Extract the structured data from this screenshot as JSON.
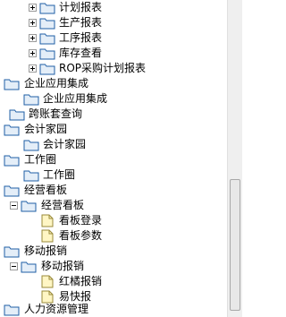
{
  "tree": {
    "items": [
      {
        "label": "计划报表",
        "icon": "folder-icon"
      },
      {
        "label": "生产报表",
        "icon": "folder-icon"
      },
      {
        "label": "工序报表",
        "icon": "folder-icon"
      },
      {
        "label": "库存查看",
        "icon": "folder-icon"
      },
      {
        "label": "ROP采购计划报表",
        "icon": "folder-icon"
      },
      {
        "label": "企业应用集成",
        "icon": "folder-icon"
      },
      {
        "label": "企业应用集成",
        "icon": "folder-icon"
      },
      {
        "label": "跨账套查询",
        "icon": "folder-icon"
      },
      {
        "label": "会计家园",
        "icon": "folder-icon"
      },
      {
        "label": "会计家园",
        "icon": "folder-icon"
      },
      {
        "label": "工作圈",
        "icon": "folder-icon"
      },
      {
        "label": "工作圈",
        "icon": "folder-icon"
      },
      {
        "label": "经营看板",
        "icon": "folder-icon"
      },
      {
        "label": "经营看板",
        "icon": "folder-icon"
      },
      {
        "label": "看板登录",
        "icon": "document-icon"
      },
      {
        "label": "看板参数",
        "icon": "document-icon"
      },
      {
        "label": "移动报销",
        "icon": "folder-icon"
      },
      {
        "label": "移动报销",
        "icon": "folder-icon"
      },
      {
        "label": "红橘报销",
        "icon": "document-icon"
      },
      {
        "label": "易快报",
        "icon": "document-icon"
      },
      {
        "label": "人力资源管理",
        "icon": "folder-icon"
      }
    ]
  },
  "colors": {
    "folder_fill": "#e4eef8",
    "folder_stroke": "#1f5fa6",
    "document_fill": "#fff6c4",
    "document_stroke": "#9a8a3a",
    "scrollbar_track": "#efefef"
  }
}
